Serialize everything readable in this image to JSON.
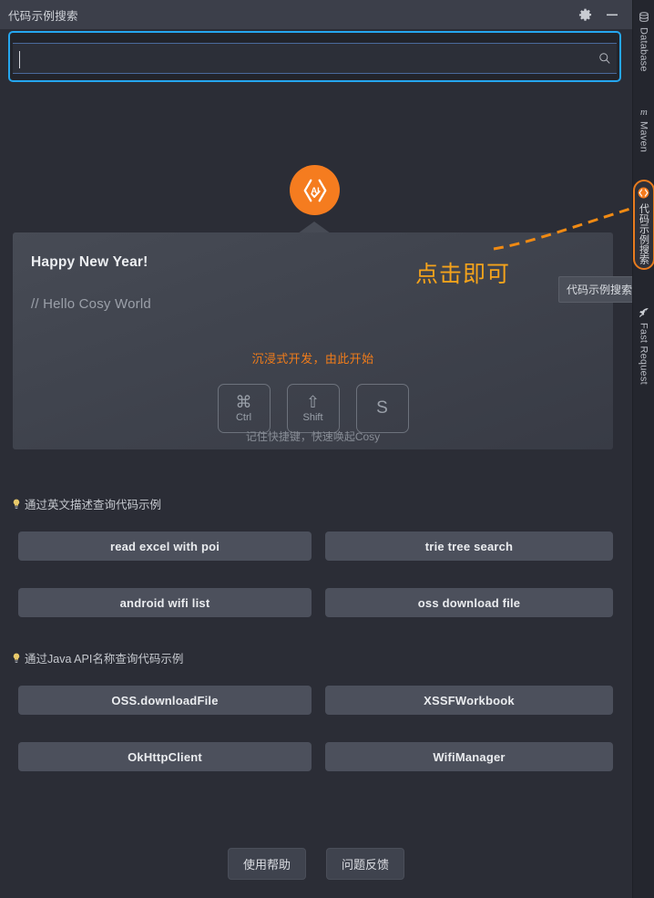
{
  "window": {
    "title": "代码示例搜索",
    "settings_icon": "gear-icon",
    "minimize_icon": "minimize-icon"
  },
  "search": {
    "value": "",
    "placeholder": "",
    "icon": "search-icon"
  },
  "logo": {
    "icon": "cosy-ai-logo-icon",
    "accent_color": "#f57c1f"
  },
  "card": {
    "title": "Happy New Year!",
    "subtitle": "// Hello Cosy World",
    "tagline": "沉浸式开发，由此开始",
    "hint": "记住快捷键，快速唤起Cosy",
    "keys": [
      {
        "glyph": "⌘",
        "name": "Ctrl"
      },
      {
        "glyph": "⇧",
        "name": "Shift"
      },
      {
        "glyph": "S",
        "name": ""
      }
    ]
  },
  "annotation": {
    "text": "点击即可",
    "color": "#f5a31b",
    "arrow_icon": "dashed-curve-arrow-icon"
  },
  "tooltip": {
    "text": "代码示例搜索"
  },
  "sections": [
    {
      "icon": "lightbulb-icon",
      "title": "通过英文描述查询代码示例",
      "chips": [
        "read excel with poi",
        "trie tree search",
        "android wifi list",
        "oss download file"
      ]
    },
    {
      "icon": "lightbulb-icon",
      "title": "通过Java API名称查询代码示例",
      "chips": [
        "OSS.downloadFile",
        "XSSFWorkbook",
        "OkHttpClient",
        "WifiManager"
      ]
    }
  ],
  "footer": {
    "help_label": "使用帮助",
    "feedback_label": "问题反馈"
  },
  "toolstrip": {
    "items": [
      {
        "label": "Database",
        "icon": "database-icon",
        "selected": false
      },
      {
        "label": "Maven",
        "icon": "maven-m-icon",
        "selected": false
      },
      {
        "label": "代码示例搜索",
        "icon": "cosy-ai-logo-icon",
        "selected": true
      },
      {
        "label": "Fast Request",
        "icon": "rocket-icon",
        "selected": false
      }
    ]
  }
}
